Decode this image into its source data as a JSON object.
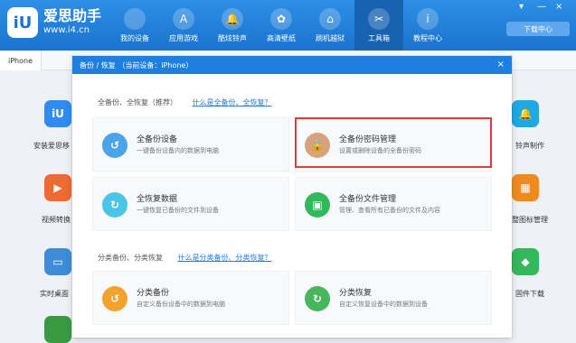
{
  "app": {
    "title": "爱思助手",
    "url": "www.i4.cn",
    "logo_text": "iU"
  },
  "nav": [
    {
      "label": "我的设备",
      "icon": "apple-icon",
      "glyph": ""
    },
    {
      "label": "应用游戏",
      "icon": "appstore-icon",
      "glyph": "A"
    },
    {
      "label": "酷炫铃声",
      "icon": "bell-icon",
      "glyph": "🔔"
    },
    {
      "label": "高清壁纸",
      "icon": "flower-icon",
      "glyph": "✿"
    },
    {
      "label": "刷机越狱",
      "icon": "box-icon",
      "glyph": "⌂"
    },
    {
      "label": "工具箱",
      "icon": "tools-icon",
      "glyph": "✂"
    },
    {
      "label": "教程中心",
      "icon": "info-icon",
      "glyph": "i"
    }
  ],
  "download_center": "下载中心",
  "subbar": {
    "tab": "iPhone"
  },
  "side_left": [
    {
      "label": "安装爱思移",
      "glyph": "iU",
      "color": "#2f8bef"
    },
    {
      "label": "视频转换",
      "glyph": "▶",
      "color": "#f06a33"
    },
    {
      "label": "实时桌面",
      "glyph": "▭",
      "color": "#3e8bd8"
    },
    {
      "label": "",
      "glyph": "",
      "color": "#3a9a43"
    }
  ],
  "side_right": [
    {
      "label": "铃声制作",
      "glyph": "🔔",
      "color": "#1fa8e6"
    },
    {
      "label": "整图标管理",
      "glyph": "▦",
      "color": "#f08a1f"
    },
    {
      "label": "固件下载",
      "glyph": "◆",
      "color": "#33b85b"
    }
  ],
  "modal": {
    "title": "备份 / 恢复   （当前设备：iPhone）",
    "close": "×",
    "section1": {
      "title": "全备份、全恢复（推荐）",
      "link": "什么是全备份、全恢复？"
    },
    "section2": {
      "title": "分类备份、分类恢复",
      "link": "什么是分类备份、分类恢复？"
    },
    "cards": [
      {
        "title": "全备份设备",
        "desc": "一键备份设备内的数据到电脑",
        "icon": "backup-icon",
        "glyph": "↺",
        "color": "#4aa4ea"
      },
      {
        "title": "全备份密码管理",
        "desc": "设置或删除设备的全备份密码",
        "icon": "lock-icon",
        "glyph": "🔒",
        "color": "#d8a27d"
      },
      {
        "title": "全恢复数据",
        "desc": "一键恢复已备份的文件到设备",
        "icon": "restore-icon",
        "glyph": "↻",
        "color": "#4cc4e8"
      },
      {
        "title": "全备份文件管理",
        "desc": "管理、查看所有已备份的文件及内容",
        "icon": "folder-icon",
        "glyph": "▣",
        "color": "#33b85b"
      },
      {
        "title": "分类备份",
        "desc": "自定义备份设备中的数据到电脑",
        "icon": "category-backup-icon",
        "glyph": "↺",
        "color": "#f4a22b"
      },
      {
        "title": "分类恢复",
        "desc": "自定义恢复设备中的数据到设备",
        "icon": "category-restore-icon",
        "glyph": "↻",
        "color": "#47b65c"
      }
    ]
  }
}
